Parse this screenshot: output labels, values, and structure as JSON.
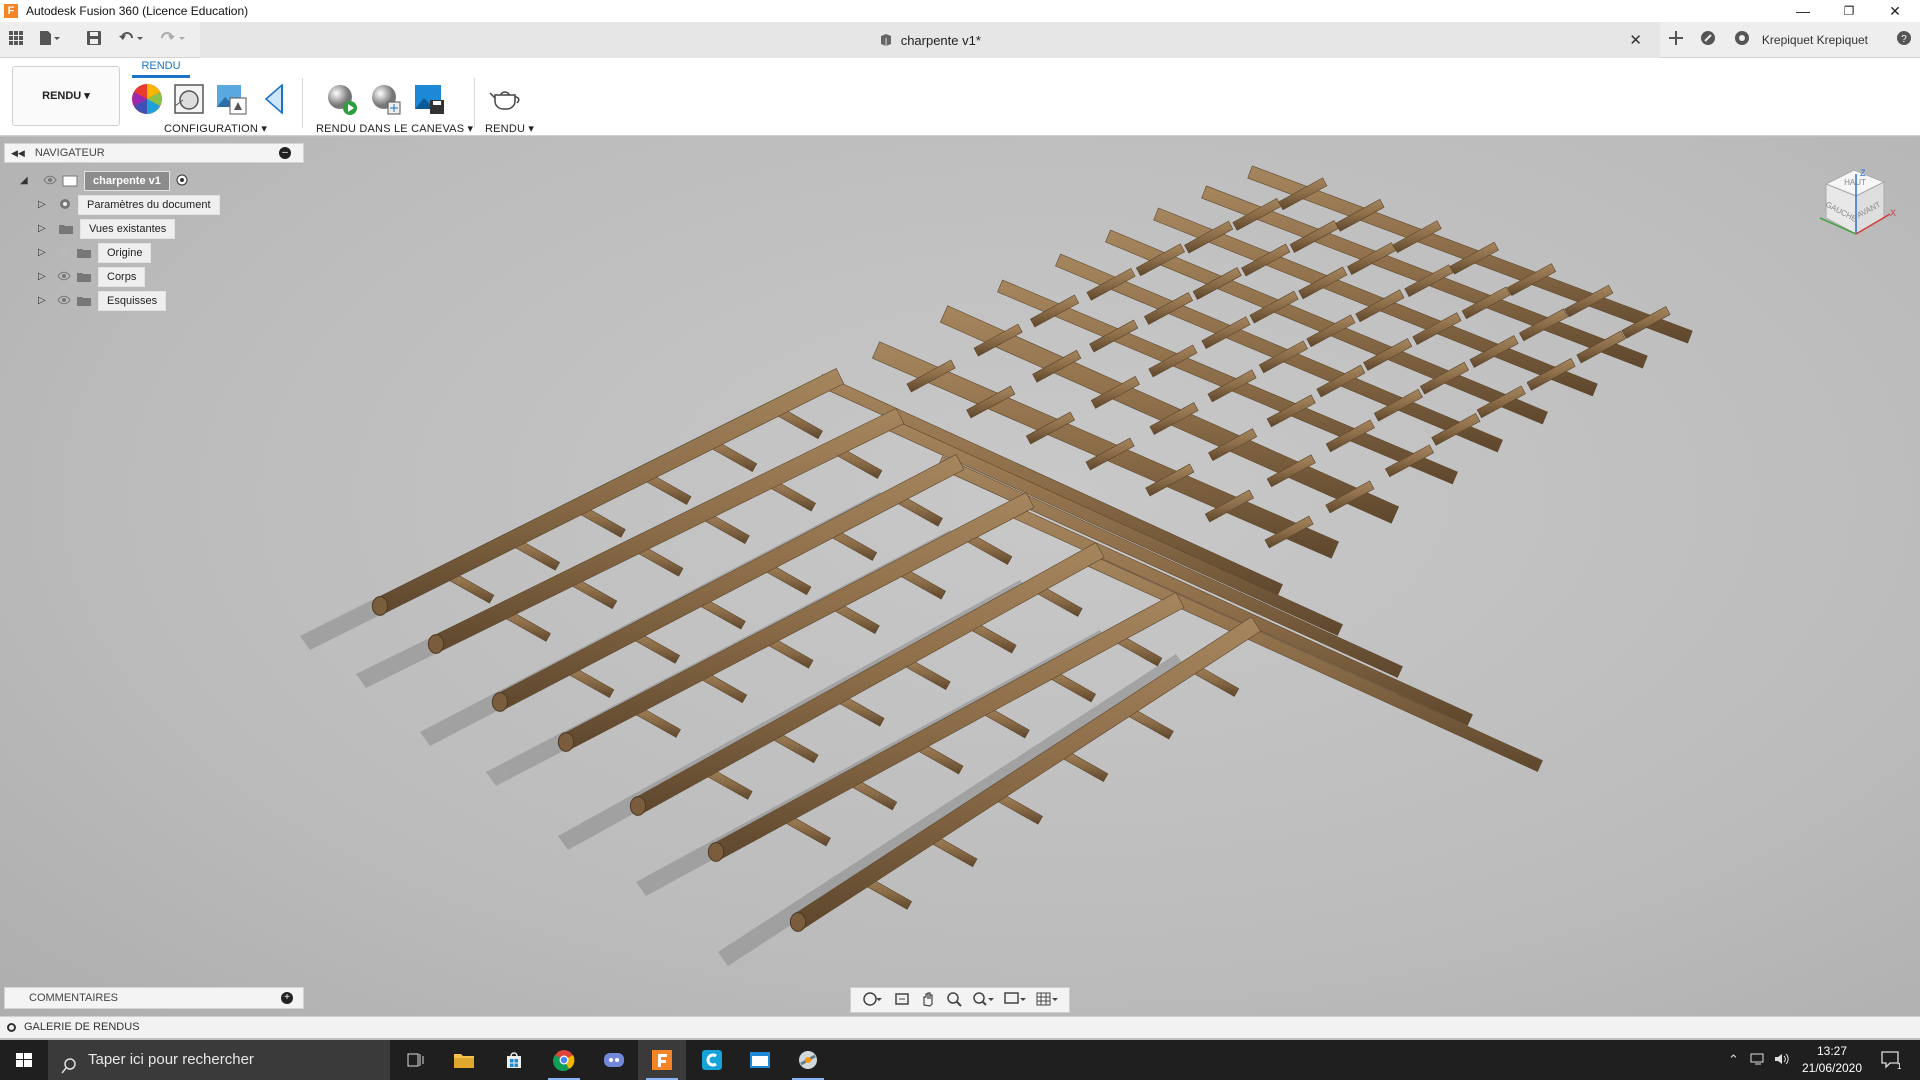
{
  "window": {
    "title": "Autodesk Fusion 360 (Licence Education)",
    "app_icon_letter": "F",
    "minimize": "—",
    "restore": "❐",
    "close": "✕"
  },
  "document": {
    "tab_title": "charpente v1*",
    "close_label": "✕"
  },
  "user": {
    "name": "Krepiquet Krepiquet"
  },
  "toolbar": {
    "workspace_label": "RENDU ▾",
    "active_tab": "RENDU",
    "groups": {
      "configuration": "CONFIGURATION ▾",
      "rendu_canevas": "RENDU DANS LE CANEVAS ▾",
      "rendu": "RENDU ▾"
    }
  },
  "navigator": {
    "header": "NAVIGATEUR",
    "root": "charpente v1",
    "items": [
      {
        "label": "Paramètres du document",
        "icon": "gear-icon"
      },
      {
        "label": "Vues existantes",
        "icon": "folder-icon"
      },
      {
        "label": "Origine",
        "icon": "folder-icon"
      },
      {
        "label": "Corps",
        "icon": "folder-icon"
      },
      {
        "label": "Esquisses",
        "icon": "folder-icon"
      }
    ]
  },
  "viewcube": {
    "top": "HAUT",
    "left": "GAUCHE",
    "front": "AVANT",
    "axis_z": "Z",
    "axis_x": "X"
  },
  "comments": {
    "label": "COMMENTAIRES",
    "plus": "+"
  },
  "gallery": {
    "label": "GALERIE DE RENDUS"
  },
  "taskbar": {
    "search_placeholder": "Taper ici pour rechercher",
    "time": "13:27",
    "date": "21/06/2020",
    "notifications": "1"
  },
  "colors": {
    "accent": "#1a73c8",
    "wood": "#8b6c48",
    "wood_dark": "#5e472d",
    "wood_light": "#a5865e",
    "taskbar": "#1f1f1f"
  }
}
